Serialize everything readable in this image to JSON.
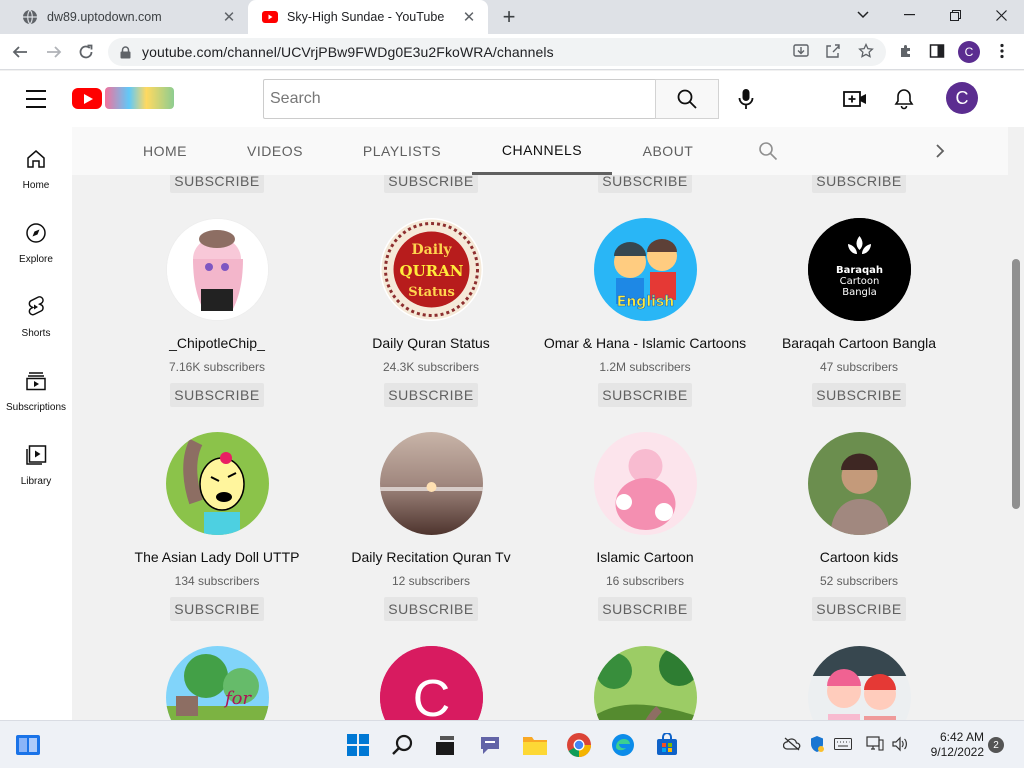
{
  "browser": {
    "tabs": [
      {
        "title": "dw89.uptodown.com",
        "active": false
      },
      {
        "title": "Sky-High Sundae - YouTube",
        "active": true
      }
    ],
    "url": "youtube.com/channel/UCVrjPBw9FWDg0E3u2FkoWRA/channels",
    "profile_initial": "C"
  },
  "youtube": {
    "search_placeholder": "Search",
    "account_initial": "C",
    "guide": [
      {
        "label": "Home",
        "icon": "home-icon"
      },
      {
        "label": "Explore",
        "icon": "compass-icon"
      },
      {
        "label": "Shorts",
        "icon": "shorts-icon"
      },
      {
        "label": "Subscriptions",
        "icon": "subscriptions-icon"
      },
      {
        "label": "Library",
        "icon": "library-icon"
      }
    ],
    "channel_tabs": [
      "HOME",
      "VIDEOS",
      "PLAYLISTS",
      "CHANNELS",
      "ABOUT"
    ],
    "selected_tab": "CHANNELS",
    "subscribe_label": "SUBSCRIBE",
    "channels": [
      {
        "name": "_ChipotleChip_",
        "subscribers": "7.16K subscribers",
        "avatar": "anime girl drawing",
        "color": "#f5e6ef"
      },
      {
        "name": "Daily Quran Status",
        "subscribers": "24.3K subscribers",
        "avatar": "Daily QURAN Status badge",
        "color": "#b71c1c",
        "avatar_text": [
          "Daily",
          "QURAN",
          "Status"
        ]
      },
      {
        "name": "Omar & Hana - Islamic Cartoons",
        "subscribers": "1.2M subscribers",
        "avatar": "cartoon kids English",
        "color": "#29b6f6",
        "avatar_text": [
          "English"
        ]
      },
      {
        "name": "Baraqah Cartoon Bangla",
        "subscribers": "47 subscribers",
        "avatar": "Baraqah logo",
        "color": "#000000",
        "avatar_text": [
          "Baraqah",
          "Cartoon",
          "Bangla"
        ]
      },
      {
        "name": "The Asian Lady Doll UTTP",
        "subscribers": "134 subscribers",
        "avatar": "cartoon face drawing",
        "color": "#8bc34a"
      },
      {
        "name": "Daily Recitation Quran Tv",
        "subscribers": "12 subscribers",
        "avatar": "sunset over water",
        "color": "#8d6e63"
      },
      {
        "name": "Islamic Cartoon",
        "subscribers": "16 subscribers",
        "avatar": "baby photo pink",
        "color": "#f8bbd0"
      },
      {
        "name": "Cartoon kids",
        "subscribers": "52 subscribers",
        "avatar": "boy photo",
        "color": "#5d7c3e"
      },
      {
        "name": "",
        "subscribers": "",
        "avatar": "garden scene",
        "color": "#66bb6a",
        "avatar_text": [
          "for"
        ]
      },
      {
        "name": "",
        "subscribers": "",
        "avatar": "letter C",
        "color": "#d81b60",
        "avatar_text": [
          "C"
        ]
      },
      {
        "name": "",
        "subscribers": "",
        "avatar": "green cartoon landscape",
        "color": "#7cb342"
      },
      {
        "name": "",
        "subscribers": "",
        "avatar": "two babies in hats",
        "color": "#e0e0e0"
      }
    ]
  },
  "taskbar": {
    "time": "6:42 AM",
    "date": "9/12/2022",
    "notifications": "2"
  }
}
